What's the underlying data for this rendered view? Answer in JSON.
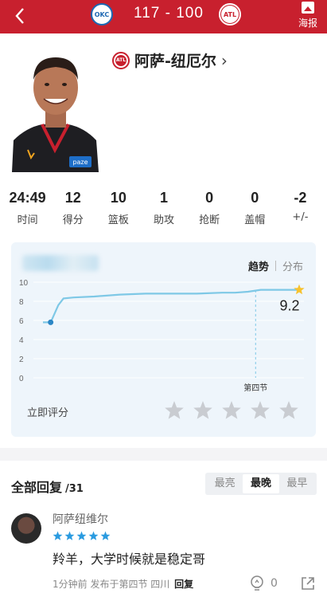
{
  "header": {
    "home_team": "OKC",
    "away_team": "ATL",
    "score": "117 - 100",
    "poster_label": "海报"
  },
  "player": {
    "team_badge": "ATL",
    "name": "阿萨-纽厄尔",
    "stats": [
      {
        "value": "24:49",
        "label": "时间"
      },
      {
        "value": "12",
        "label": "得分"
      },
      {
        "value": "10",
        "label": "篮板"
      },
      {
        "value": "1",
        "label": "助攻"
      },
      {
        "value": "0",
        "label": "抢断"
      },
      {
        "value": "0",
        "label": "盖帽"
      },
      {
        "value": "-2",
        "label": "+/-"
      }
    ]
  },
  "rating": {
    "tab_trend": "趋势",
    "tab_distribution": "分布",
    "rate_now": "立即评分",
    "current_score": "9.2",
    "user_stars": 0
  },
  "chart_data": {
    "type": "line",
    "title": "",
    "xlabel": "",
    "ylabel": "",
    "ylim": [
      0,
      10
    ],
    "yticks": [
      0,
      2,
      4,
      6,
      8,
      10
    ],
    "annotation": "第四节",
    "x": [
      0,
      0.03,
      0.06,
      0.08,
      0.12,
      0.2,
      0.3,
      0.4,
      0.5,
      0.6,
      0.7,
      0.75,
      0.8,
      0.85,
      0.9,
      0.95,
      1.0
    ],
    "values": [
      5.8,
      5.8,
      7.6,
      8.3,
      8.4,
      8.5,
      8.7,
      8.8,
      8.8,
      8.8,
      8.9,
      8.9,
      9.0,
      9.2,
      9.2,
      9.2,
      9.2
    ],
    "colors": {
      "line": "#7ec8e6",
      "start_dot": "#2b86c5",
      "end_star": "#f7c22e"
    }
  },
  "replies": {
    "title": "全部回复",
    "count": "/31",
    "sort_options": [
      "最亮",
      "最晚",
      "最早"
    ],
    "sort_active": 1,
    "items": [
      {
        "user": "阿萨纽维尔",
        "stars": 5,
        "text": "羚羊，大学时候就是稳定哥",
        "meta": "1分钟前 发布于第四节 四川",
        "reply_label": "回复",
        "likes": "0"
      }
    ]
  },
  "colors": {
    "brand": "#c8202e",
    "panel": "#eef5fb",
    "star_empty": "#c9ccd1",
    "star_blue": "#2b9be0"
  }
}
